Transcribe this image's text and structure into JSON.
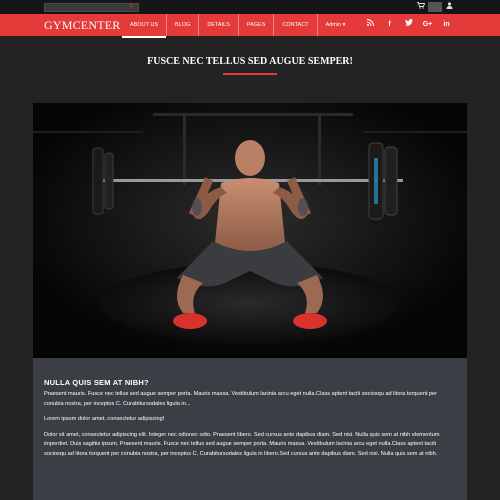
{
  "topbar": {
    "search_placeholder": "",
    "icons": [
      "cart-icon",
      "user-icon"
    ],
    "cart_glyph": "🛒",
    "user_glyph": "👤"
  },
  "navbar": {
    "brand": "GYMCENTER",
    "menu": [
      {
        "label": "ABOUT US",
        "active": true
      },
      {
        "label": "BLOG",
        "active": false
      },
      {
        "label": "DETAILS",
        "active": false
      },
      {
        "label": "PAGES",
        "active": false
      },
      {
        "label": "CONTACT",
        "active": false
      },
      {
        "label": "Admin ▾",
        "active": false
      }
    ],
    "social": [
      "rss",
      "f",
      "t",
      "G+",
      "in"
    ],
    "accent_color": "#e43a3a"
  },
  "page": {
    "title": "FUSCE NEC TELLUS SED AUGUE SEMPER!"
  },
  "content": {
    "heading": "NULLA QUIS SEM AT NIBH?",
    "para1": "Praesent mauris. Fusce nec tellus sed augue semper porta. Mauris massa. Vestibulum lacinia arcu eget nulla.Class aptent taciti sociosqu ad litora torquent per conubia nostra, per inceptos C. Curabitursodales ligula in...",
    "para2": "Lorem ipsum dolor amet, consectetur adipiscing!",
    "para3": "Dolor sit amet, consectetur adipiscing elit. Integer nec odionec odio. Praesent libero. Sed cursus ante dapibus diam. Sed nisi. Nulla quis sem at nibh elementum imperdiet. Duis sagittis ipsum. Praesent mauris. Fusce nec tellus sed augue semper porta. Mauris massa. Vestibulum lacinia arcu eget nulla.Class aptent taciti sociosqu ad litora torquent per conubia nostra, per inceptos C. Curabitursodales ligula in libero.Sed cursus ante dapibus diam. Sed nisi. Nulla quis sem at nibh."
  }
}
